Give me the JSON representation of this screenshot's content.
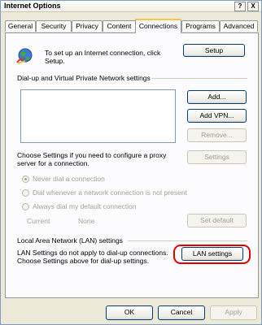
{
  "window": {
    "title": "Internet Options",
    "help_glyph": "?",
    "close_glyph": "X"
  },
  "tabs": [
    {
      "label": "General"
    },
    {
      "label": "Security"
    },
    {
      "label": "Privacy"
    },
    {
      "label": "Content"
    },
    {
      "label": "Connections",
      "active": true
    },
    {
      "label": "Programs"
    },
    {
      "label": "Advanced"
    }
  ],
  "setup": {
    "text": "To set up an Internet connection, click Setup.",
    "line1": "To set up an Internet connection, click",
    "line2": "Setup.",
    "button": "Setup"
  },
  "dialup": {
    "heading": "Dial-up and Virtual Private Network settings",
    "add": "Add...",
    "add_vpn": "Add VPN...",
    "remove": "Remove...",
    "settings": "Settings",
    "choose_line1": "Choose Settings if you need to configure a proxy",
    "choose_line2": "server for a connection.",
    "radio_never": "Never dial a connection",
    "radio_whenever": "Dial whenever a network connection is not present",
    "radio_always": "Always dial my default connection",
    "current_label": "Current",
    "current_value": "None",
    "set_default": "Set default"
  },
  "lan": {
    "heading": "Local Area Network (LAN) settings",
    "line1": "LAN Settings do not apply to dial-up connections.",
    "line2": "Choose Settings above for dial-up settings.",
    "button": "LAN settings"
  },
  "footer": {
    "ok": "OK",
    "cancel": "Cancel",
    "apply": "Apply"
  },
  "colors": {
    "highlight": "#e00000",
    "active_tab_accent": "#ffc83c"
  },
  "icons": {
    "setup": "globe-connection-icon"
  }
}
